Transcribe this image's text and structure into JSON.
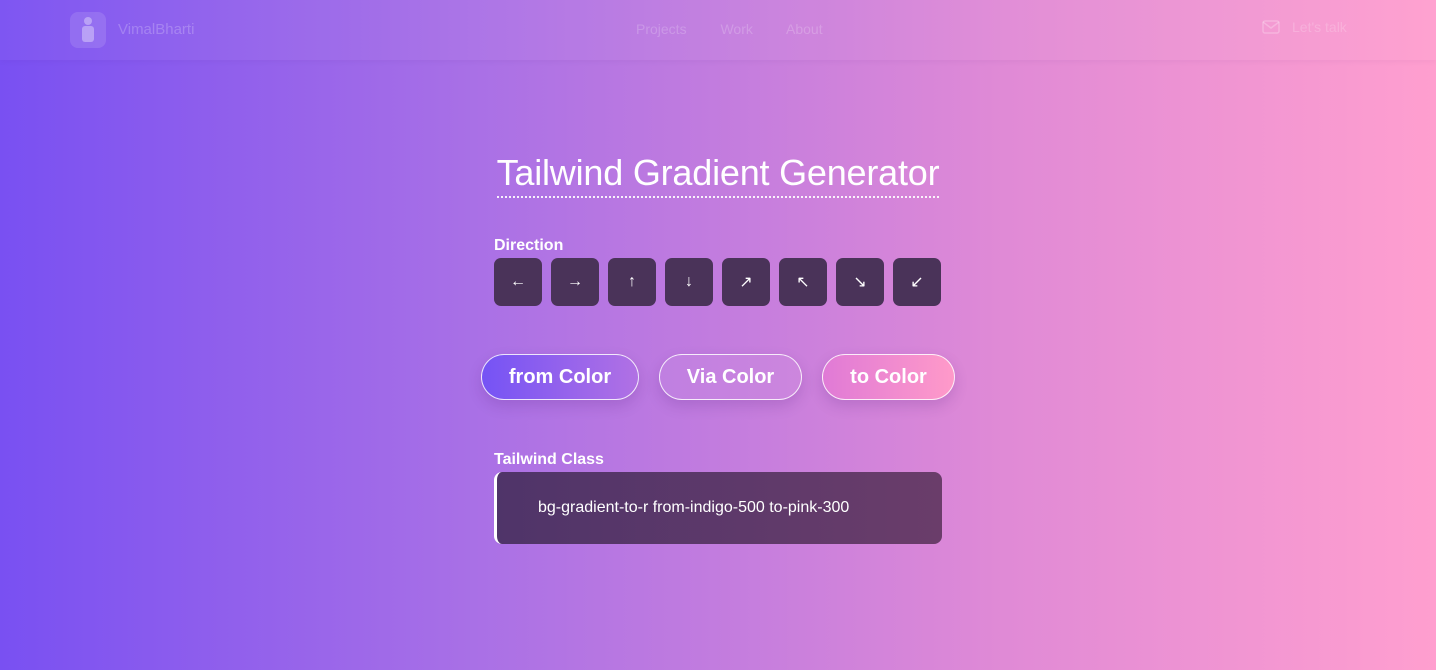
{
  "navbar": {
    "brand": "VimalBharti",
    "links": [
      "Projects",
      "Work",
      "About"
    ],
    "contact_label": "Let's talk"
  },
  "page": {
    "title": "Tailwind Gradient Generator"
  },
  "direction": {
    "label": "Direction",
    "buttons": [
      {
        "icon": "arrow-left-icon",
        "glyph": "←"
      },
      {
        "icon": "arrow-right-icon",
        "glyph": "→"
      },
      {
        "icon": "arrow-up-icon",
        "glyph": "↑"
      },
      {
        "icon": "arrow-down-icon",
        "glyph": "↓"
      },
      {
        "icon": "arrow-up-right-icon",
        "glyph": "↗"
      },
      {
        "icon": "arrow-up-left-icon",
        "glyph": "↖"
      },
      {
        "icon": "arrow-down-right-icon",
        "glyph": "↘"
      },
      {
        "icon": "arrow-down-left-icon",
        "glyph": "↙"
      }
    ]
  },
  "colors": {
    "from_label": "from Color",
    "via_label": "Via Color",
    "to_label": "to Color"
  },
  "output": {
    "label": "Tailwind Class",
    "value": "bg-gradient-to-r from-indigo-500 to-pink-300"
  },
  "theme": {
    "gradient_from": "#7950f2",
    "gradient_to": "#ff9fcf",
    "button_bg": "#4a3359"
  }
}
